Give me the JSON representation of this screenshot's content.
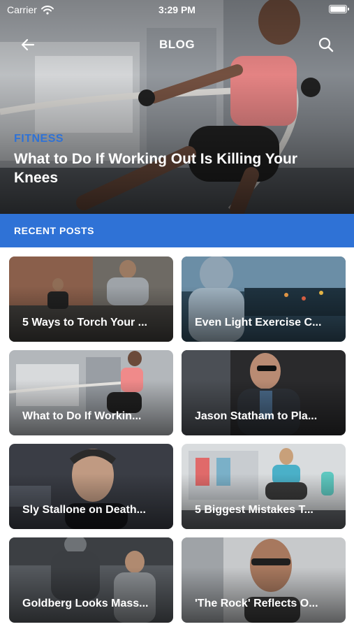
{
  "status_bar": {
    "carrier": "Carrier",
    "time": "3:29 PM"
  },
  "nav": {
    "title": "BLOG"
  },
  "hero": {
    "category": "FITNESS",
    "headline": "What to Do If Working Out Is Killing Your Knees"
  },
  "section": {
    "title": "RECENT POSTS"
  },
  "posts": [
    {
      "title": "5 Ways to Torch Your ..."
    },
    {
      "title": "Even Light Exercise C..."
    },
    {
      "title": "What to Do If Workin..."
    },
    {
      "title": "Jason Statham to Pla..."
    },
    {
      "title": "Sly Stallone on Death..."
    },
    {
      "title": "5 Biggest Mistakes T..."
    },
    {
      "title": "Goldberg Looks Mass..."
    },
    {
      "title": "'The Rock' Reflects O..."
    }
  ],
  "colors": {
    "accent": "#2f72d6",
    "text_on_image": "#ffffff",
    "background": "#ffffff"
  },
  "icons": {
    "back": "arrow-left-icon",
    "search": "search-icon",
    "wifi": "wifi-icon",
    "battery": "battery-icon"
  }
}
